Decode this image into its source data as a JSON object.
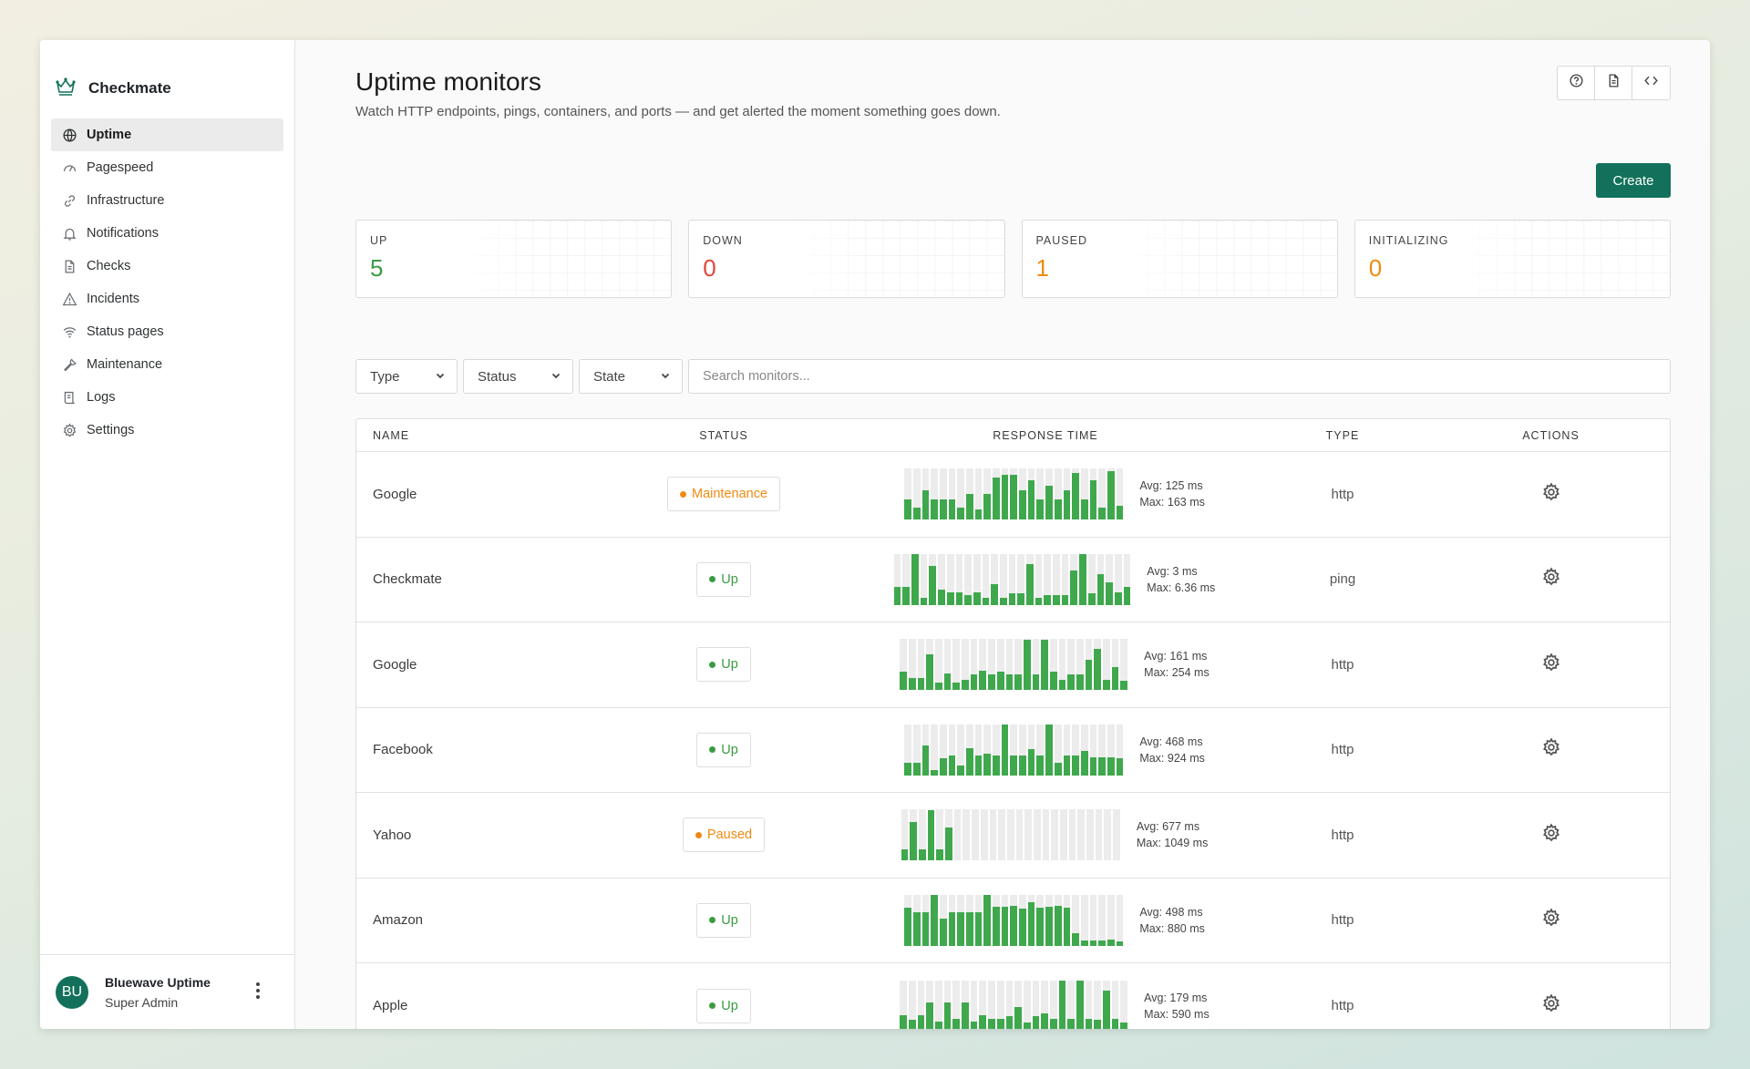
{
  "app": {
    "name": "Checkmate"
  },
  "sidebar": {
    "items": [
      {
        "label": "Uptime",
        "icon": "globe-icon",
        "active": true
      },
      {
        "label": "Pagespeed",
        "icon": "gauge-icon",
        "active": false
      },
      {
        "label": "Infrastructure",
        "icon": "link-icon",
        "active": false
      },
      {
        "label": "Notifications",
        "icon": "bell-icon",
        "active": false
      },
      {
        "label": "Checks",
        "icon": "document-icon",
        "active": false
      },
      {
        "label": "Incidents",
        "icon": "warning-icon",
        "active": false
      },
      {
        "label": "Status pages",
        "icon": "wifi-icon",
        "active": false
      },
      {
        "label": "Maintenance",
        "icon": "wrench-icon",
        "active": false
      },
      {
        "label": "Logs",
        "icon": "scroll-icon",
        "active": false
      },
      {
        "label": "Settings",
        "icon": "gear-icon",
        "active": false
      }
    ]
  },
  "user": {
    "initials": "BU",
    "name": "Bluewave Uptime",
    "role": "Super Admin"
  },
  "header": {
    "title": "Uptime monitors",
    "description": "Watch HTTP endpoints, pings, containers, and ports — and get alerted the moment something goes down.",
    "create_label": "Create"
  },
  "stats": [
    {
      "label": "UP",
      "value": "5",
      "color": "#3a9b43"
    },
    {
      "label": "DOWN",
      "value": "0",
      "color": "#e0463a"
    },
    {
      "label": "PAUSED",
      "value": "1",
      "color": "#ef8a12"
    },
    {
      "label": "INITIALIZING",
      "value": "0",
      "color": "#ef8a12"
    }
  ],
  "filters": {
    "type_label": "Type",
    "status_label": "Status",
    "state_label": "State",
    "search_placeholder": "Search monitors..."
  },
  "table": {
    "columns": {
      "name": "NAME",
      "status": "STATUS",
      "response": "RESPONSE TIME",
      "type": "TYPE",
      "actions": "ACTIONS"
    },
    "rows": [
      {
        "name": "Google",
        "status": "Maintenance",
        "status_color": "#ef8a12",
        "avg": "Avg: 125 ms",
        "max": "Max: 163 ms",
        "type": "http",
        "bars": [
          0.4,
          0.24,
          0.58,
          0.4,
          0.4,
          0.4,
          0.24,
          0.5,
          0.2,
          0.5,
          0.83,
          0.88,
          0.88,
          0.58,
          0.78,
          0.4,
          0.67,
          0.4,
          0.58,
          0.92,
          0.4,
          0.78,
          0.24,
          0.96,
          0.27
        ]
      },
      {
        "name": "Checkmate",
        "status": "Up",
        "status_color": "#3a9b43",
        "avg": "Avg: 3 ms",
        "max": "Max: 6.36 ms",
        "type": "ping",
        "bars": [
          0.36,
          0.36,
          1.0,
          0.13,
          0.76,
          0.3,
          0.25,
          0.25,
          0.19,
          0.25,
          0.13,
          0.4,
          0.13,
          0.23,
          0.23,
          0.8,
          0.13,
          0.19,
          0.19,
          0.19,
          0.68,
          0.99,
          0.23,
          0.6,
          0.44,
          0.25,
          0.36
        ]
      },
      {
        "name": "Google",
        "status": "Up",
        "status_color": "#3a9b43",
        "avg": "Avg: 161 ms",
        "max": "Max: 254 ms",
        "type": "http",
        "bars": [
          0.36,
          0.24,
          0.24,
          0.7,
          0.14,
          0.33,
          0.14,
          0.2,
          0.3,
          0.38,
          0.3,
          0.36,
          0.3,
          0.3,
          0.99,
          0.3,
          0.99,
          0.36,
          0.2,
          0.3,
          0.3,
          0.6,
          0.8,
          0.2,
          0.46,
          0.19
        ]
      },
      {
        "name": "Facebook",
        "status": "Up",
        "status_color": "#3a9b43",
        "avg": "Avg: 468 ms",
        "max": "Max: 924 ms",
        "type": "http",
        "bars": [
          0.24,
          0.24,
          0.58,
          0.1,
          0.34,
          0.38,
          0.2,
          0.54,
          0.38,
          0.42,
          0.38,
          1.0,
          0.38,
          0.38,
          0.52,
          0.38,
          0.99,
          0.24,
          0.38,
          0.38,
          0.48,
          0.36,
          0.36,
          0.36,
          0.34
        ]
      },
      {
        "name": "Yahoo",
        "status": "Paused",
        "status_color": "#ef8a12",
        "avg": "Avg: 677 ms",
        "max": "Max: 1049 ms",
        "type": "http",
        "bars": [
          0.22,
          0.76,
          0.22,
          0.99,
          0.22,
          0.65,
          0,
          0,
          0,
          0,
          0,
          0,
          0,
          0,
          0,
          0,
          0,
          0,
          0,
          0,
          0,
          0,
          0,
          0,
          0
        ]
      },
      {
        "name": "Amazon",
        "status": "Up",
        "status_color": "#3a9b43",
        "avg": "Avg: 498 ms",
        "max": "Max: 880 ms",
        "type": "http",
        "bars": [
          0.74,
          0.66,
          0.66,
          1.0,
          0.54,
          0.66,
          0.66,
          0.66,
          0.66,
          1.0,
          0.76,
          0.76,
          0.78,
          0.72,
          0.86,
          0.74,
          0.76,
          0.78,
          0.74,
          0.24,
          0.1,
          0.1,
          0.1,
          0.12,
          0.08
        ]
      },
      {
        "name": "Apple",
        "status": "Up",
        "status_color": "#3a9b43",
        "avg": "Avg: 179 ms",
        "max": "Max: 590 ms",
        "type": "http",
        "bars": [
          0.32,
          0.22,
          0.32,
          0.56,
          0.2,
          0.56,
          0.24,
          0.56,
          0.2,
          0.32,
          0.24,
          0.24,
          0.3,
          0.47,
          0.18,
          0.3,
          0.36,
          0.24,
          1.0,
          0.24,
          0.99,
          0.24,
          0.22,
          0.8,
          0.24,
          0.18
        ]
      }
    ]
  }
}
